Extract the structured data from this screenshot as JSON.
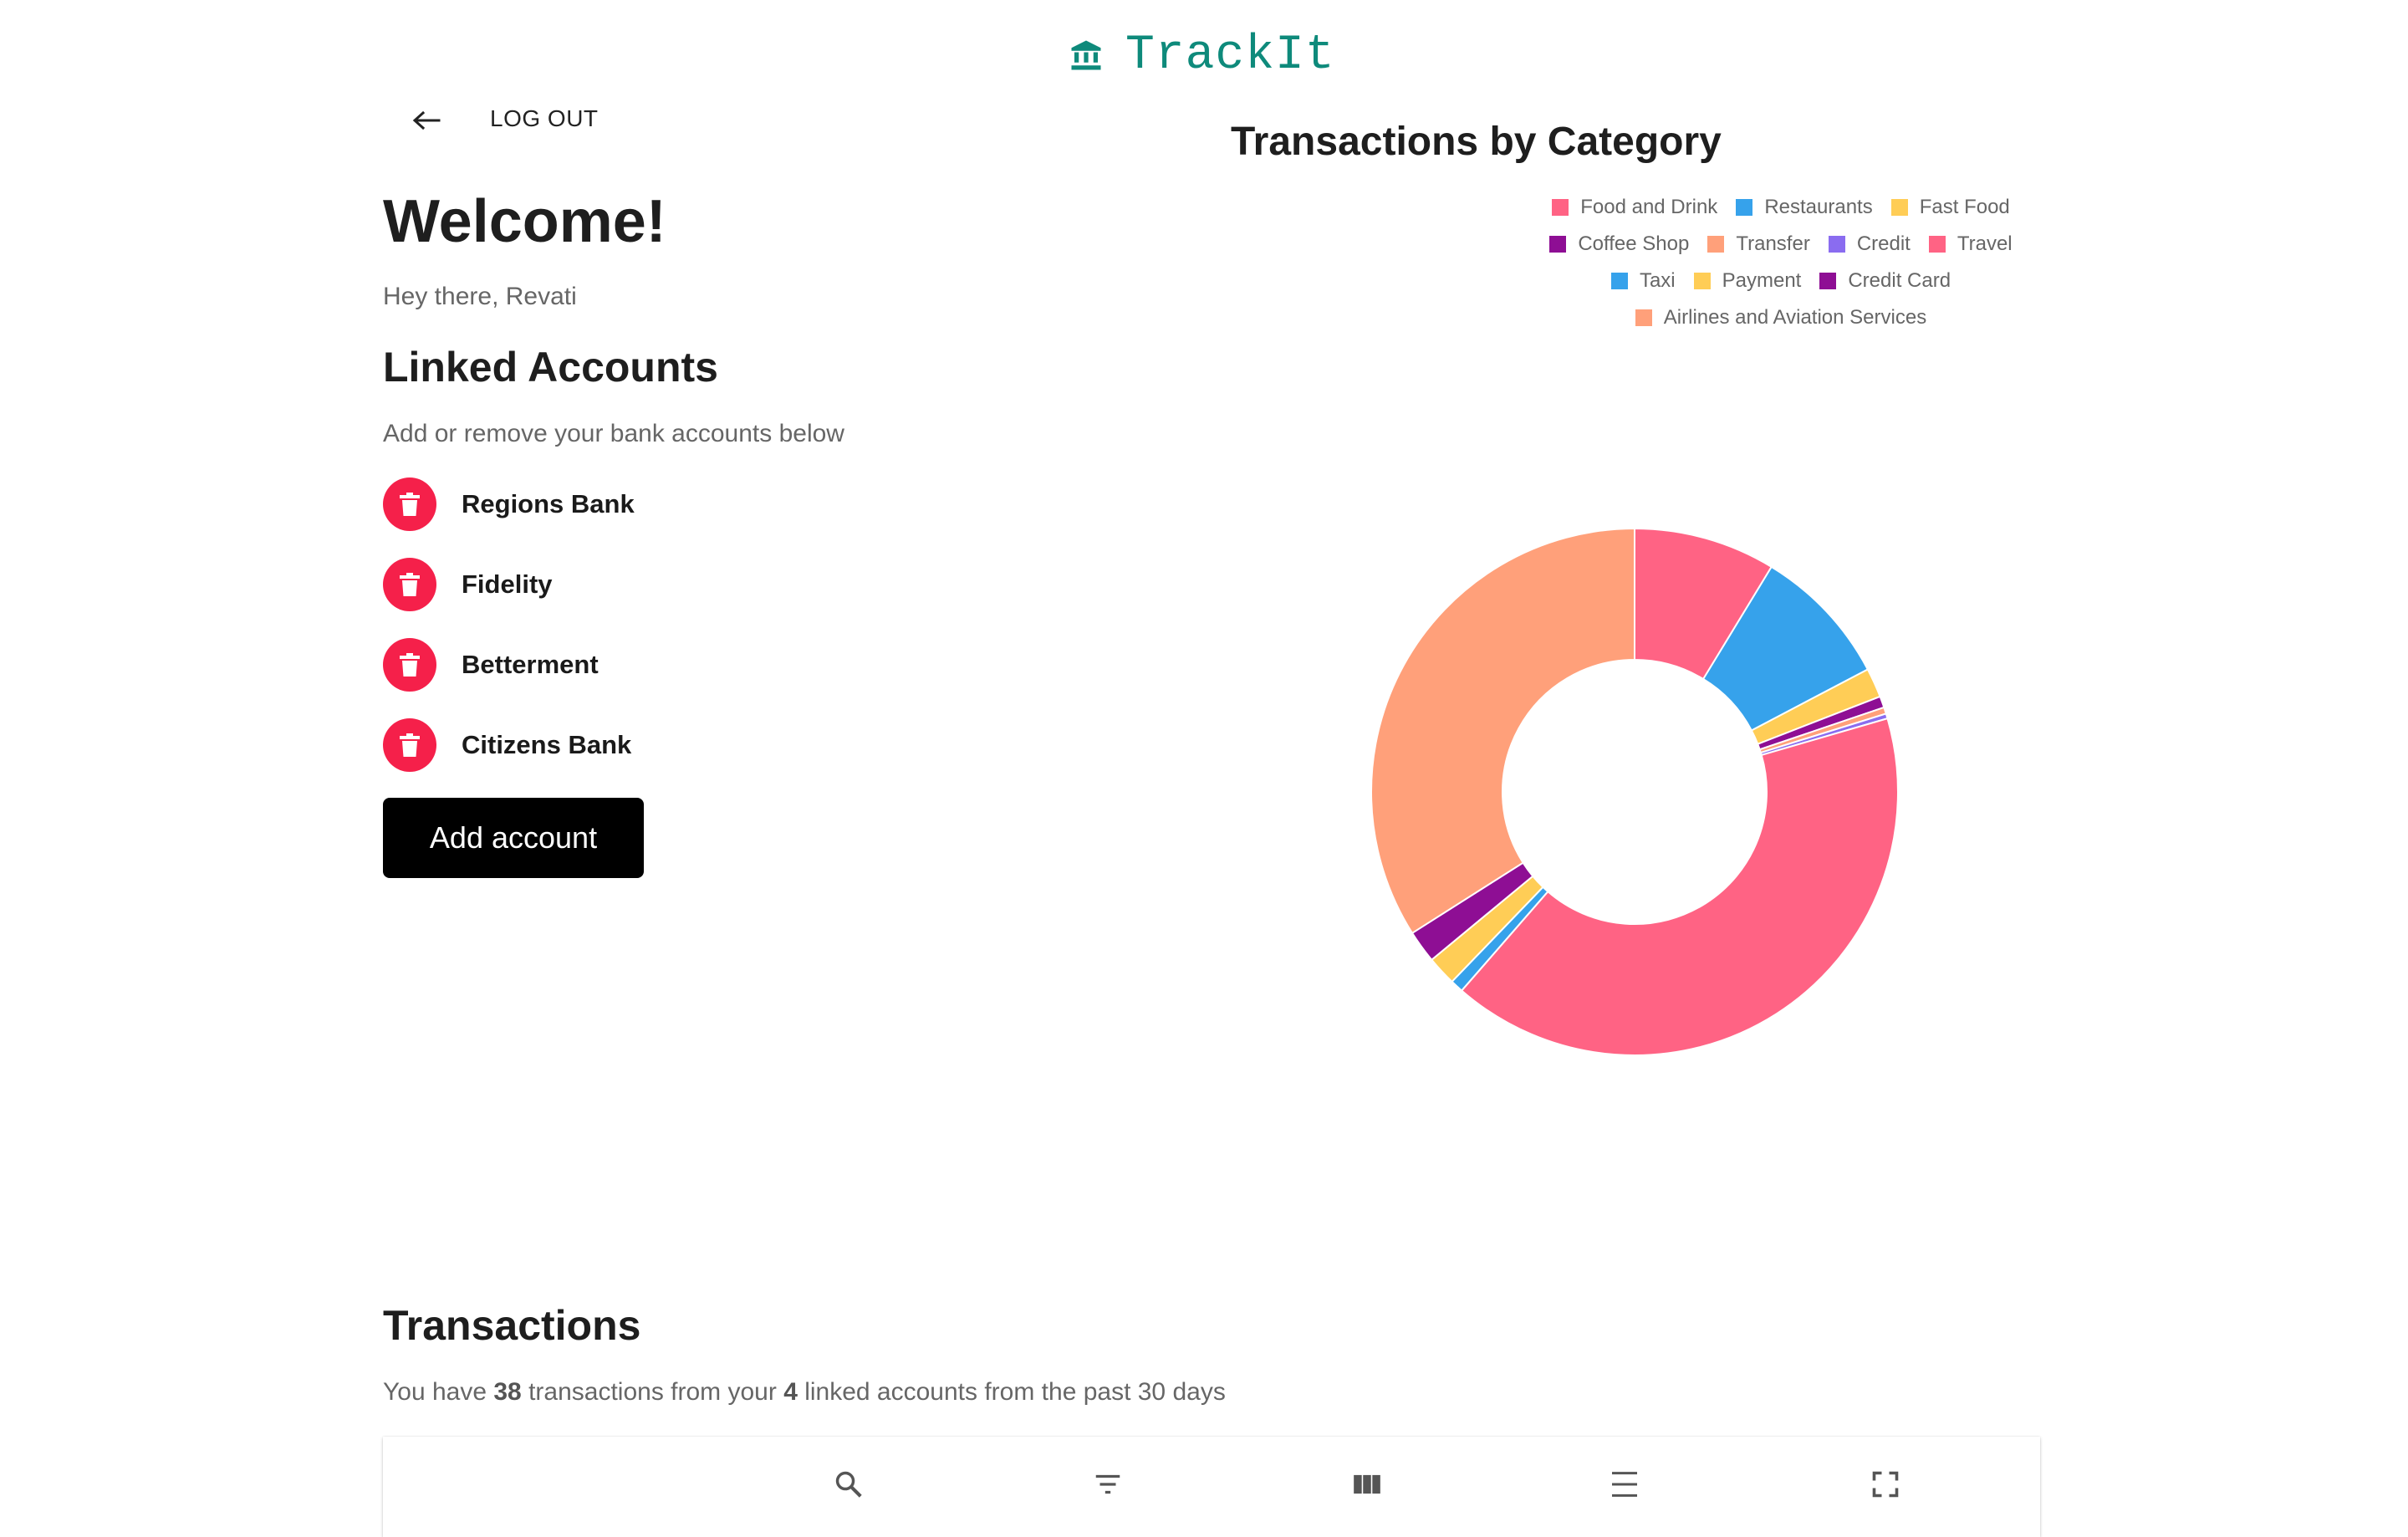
{
  "app": {
    "name": "TrackIt",
    "icon": "bank-icon",
    "brand_color": "#0e8a7b"
  },
  "nav": {
    "back_icon": "arrow-left-icon",
    "logout_label": "LOG OUT"
  },
  "welcome": {
    "title": "Welcome!",
    "greeting": "Hey there, Revati"
  },
  "linked_accounts": {
    "title": "Linked Accounts",
    "subtitle": "Add or remove your bank accounts below",
    "delete_icon": "trash-icon",
    "delete_color": "#f5204a",
    "accounts": [
      {
        "name": "Regions Bank"
      },
      {
        "name": "Fidelity"
      },
      {
        "name": "Betterment"
      },
      {
        "name": "Citizens Bank"
      }
    ],
    "add_button_label": "Add account"
  },
  "chart_data": {
    "type": "doughnut",
    "title": "Transactions by Category",
    "legend_position": "top",
    "categories": [
      "Food and Drink",
      "Restaurants",
      "Fast Food",
      "Coffee Shop",
      "Transfer",
      "Credit",
      "Travel",
      "Taxi",
      "Payment",
      "Credit Card",
      "Airlines and Aviation Services"
    ],
    "colors": [
      "#ff6384",
      "#36a2eb",
      "#ffcd56",
      "#8e0e94",
      "#ffa07a",
      "#8a6cf0",
      "#ff6384",
      "#36a2eb",
      "#ffcd56",
      "#8e0e94",
      "#ffa07a"
    ],
    "values": [
      8.7,
      8.6,
      1.8,
      0.7,
      0.4,
      0.3,
      40.9,
      0.8,
      1.8,
      2.0,
      34.0
    ]
  },
  "transactions": {
    "title": "Transactions",
    "summary_prefix": "You have ",
    "count": "38",
    "summary_mid": " transactions from your ",
    "account_count": "4",
    "summary_suffix": " linked accounts from the past 30 days",
    "toolbar": [
      {
        "icon": "search-icon"
      },
      {
        "icon": "filter-icon"
      },
      {
        "icon": "view-column-icon"
      },
      {
        "icon": "density-icon"
      },
      {
        "icon": "fullscreen-icon"
      }
    ]
  }
}
